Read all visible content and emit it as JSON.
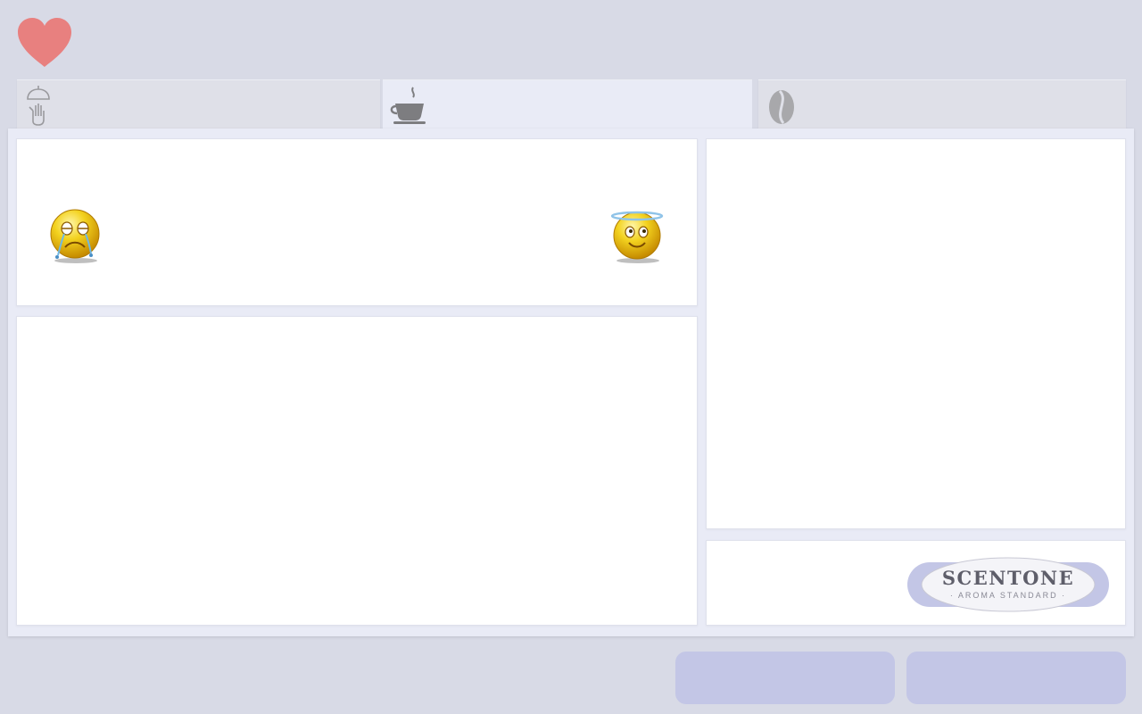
{
  "app": {
    "favorite_icon": "heart-icon",
    "favorite_color": "#e8807f"
  },
  "tabs": [
    {
      "icon": "hand-pour-icon",
      "active": false
    },
    {
      "icon": "coffee-cup-icon",
      "active": true
    },
    {
      "icon": "coffee-bean-icon",
      "active": false
    }
  ],
  "rating": {
    "low_icon": "crying-face-icon",
    "high_icon": "angel-face-icon"
  },
  "brand": {
    "name": "SCENTONE",
    "tagline": "· AROMA STANDARD ·"
  },
  "colors": {
    "background": "#d8dae6",
    "active_tab": "#e9ebf6",
    "panel": "#ffffff",
    "button": "#c3c6e6"
  },
  "actions": [
    {
      "name": "action-button-1",
      "label": ""
    },
    {
      "name": "action-button-2",
      "label": ""
    }
  ]
}
